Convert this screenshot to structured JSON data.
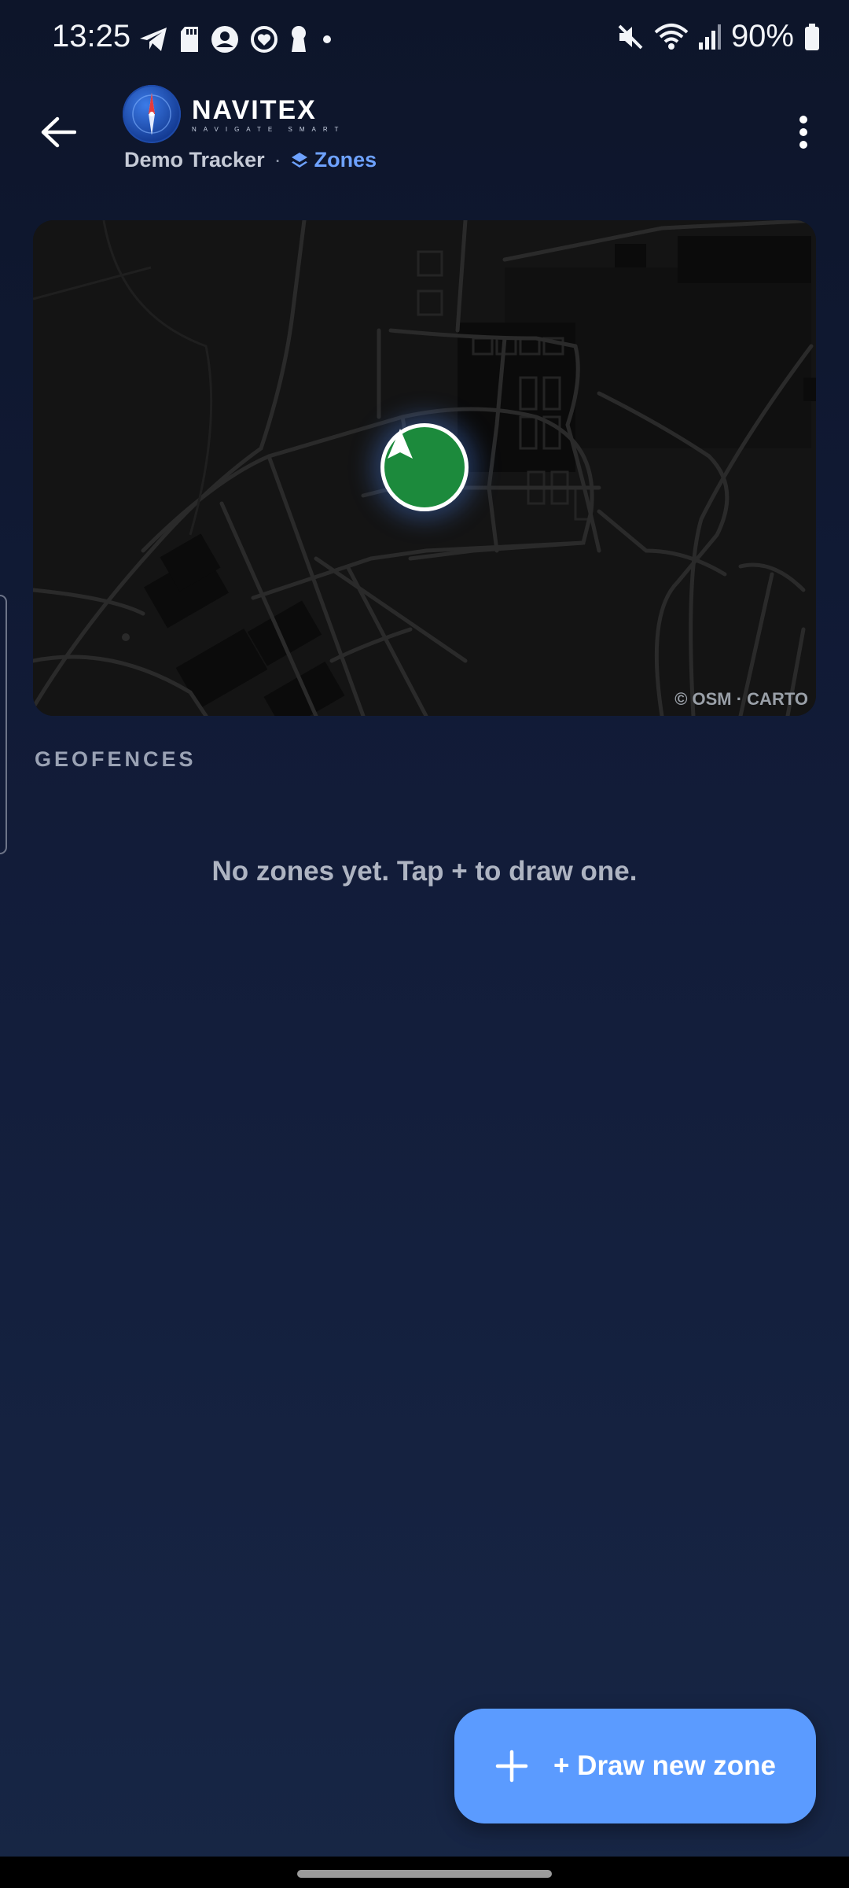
{
  "status_bar": {
    "time": "13:25",
    "left_icons": [
      "telegram-icon",
      "sd-card-icon",
      "account-circle-icon",
      "heart-sync-icon",
      "keyhole-icon",
      "dot-icon"
    ],
    "right_icons": [
      "mute-icon",
      "wifi-icon",
      "signal-icon",
      "battery-icon"
    ],
    "battery": "90%"
  },
  "app_bar": {
    "brand_name": "NAVITEX",
    "brand_tagline": "NAVIGATE SMART",
    "device_name": "Demo Tracker",
    "separator": "·",
    "section_label": "Zones"
  },
  "map": {
    "attribution": "© OSM · CARTO",
    "marker_color": "#1c8a3c"
  },
  "geofences": {
    "title": "GEOFENCES",
    "empty_message": "No zones yet. Tap + to draw one."
  },
  "fab": {
    "label": "+ Draw new zone",
    "color": "#5b9bff"
  },
  "colors": {
    "accent": "#6ea2ff",
    "background_top": "#0d152a",
    "background_bottom": "#172645"
  }
}
